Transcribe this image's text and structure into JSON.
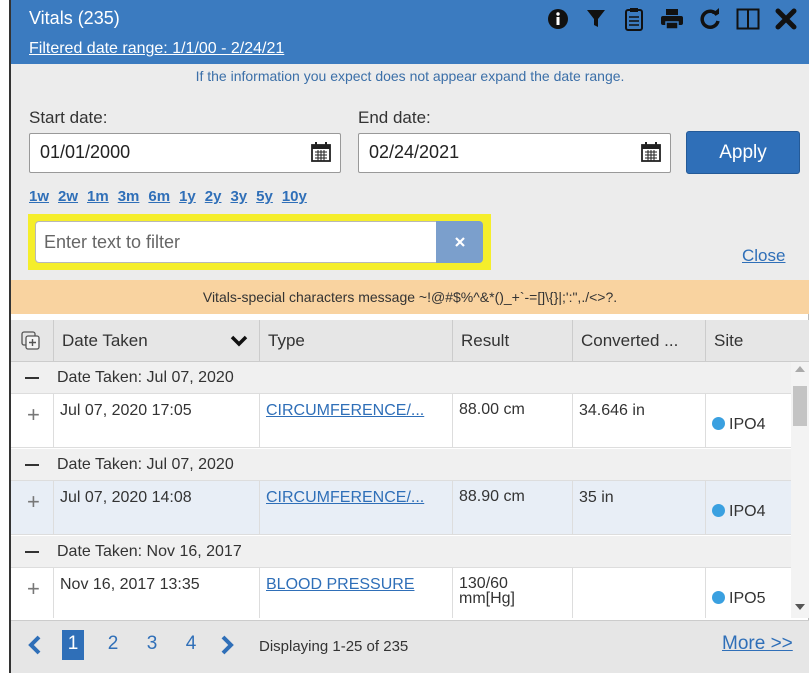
{
  "header": {
    "title": "Vitals (235)",
    "filtered_range": "Filtered date range: 1/1/00 - 2/24/21",
    "icons": [
      "info-icon",
      "filter-icon",
      "clipboard-icon",
      "print-icon",
      "refresh-icon",
      "expand-panel-icon",
      "close-icon"
    ]
  },
  "info_message": "If the information you expect does not appear expand the date range.",
  "dates": {
    "start_label": "Start date:",
    "start_value": "01/01/2000",
    "end_label": "End date:",
    "end_value": "02/24/2021",
    "apply_label": "Apply",
    "quick_ranges": [
      "1w",
      "2w",
      "1m",
      "3m",
      "6m",
      "1y",
      "2y",
      "3y",
      "5y",
      "10y"
    ]
  },
  "filter": {
    "placeholder": "Enter text to filter",
    "close_label": "Close"
  },
  "special_message": "Vitals-special characters message ~!@#$%^&*()_+`-=[]\\{}|;':\",./<>?.",
  "table": {
    "columns": {
      "date": "Date Taken",
      "type": "Type",
      "result": "Result",
      "converted": "Converted ...",
      "site": "Site"
    },
    "groups": [
      {
        "label": "Date Taken:  Jul 07, 2020",
        "row": {
          "date": "Jul 07, 2020 17:05",
          "type": "CIRCUMFERENCE/...",
          "result": "88.00 cm",
          "converted": "34.646 in",
          "site": "IPO4"
        }
      },
      {
        "label": "Date Taken:  Jul 07, 2020",
        "row": {
          "date": "Jul 07, 2020 14:08",
          "type": "CIRCUMFERENCE/...",
          "result": "88.90 cm",
          "converted": "35 in",
          "site": "IPO4"
        }
      },
      {
        "label": "Date Taken:  Nov 16, 2017",
        "row": {
          "date": "Nov 16, 2017 13:35",
          "type": "BLOOD PRESSURE",
          "result": "130/60 mm[Hg]",
          "converted": "",
          "site": "IPO5"
        }
      }
    ]
  },
  "pagination": {
    "pages": [
      "1",
      "2",
      "3",
      "4"
    ],
    "active_page": "1",
    "displaying": "Displaying 1-25 of 235",
    "more_label": "More >>"
  },
  "colors": {
    "header_bg": "#3b7bc0",
    "accent": "#2f6fb8",
    "highlight": "#f5ee2b",
    "message_bg": "#f9d3a0",
    "site_dot": "#3aa0e0"
  }
}
